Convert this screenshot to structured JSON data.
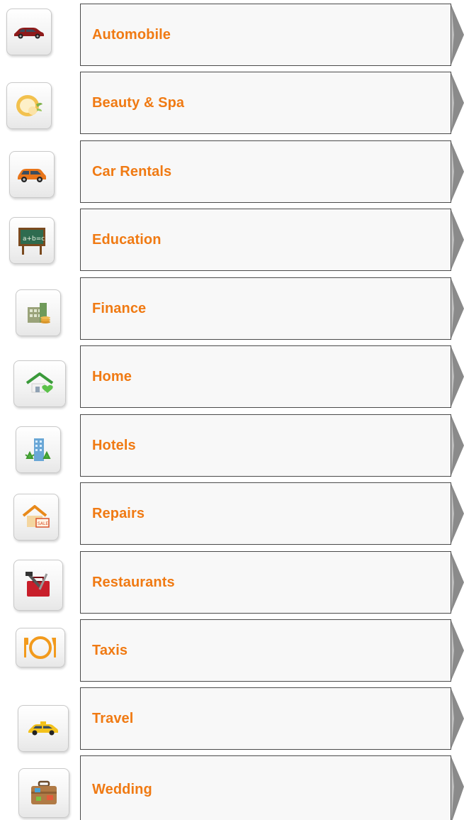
{
  "categories": [
    {
      "label": "Automobile",
      "icon": "car-icon"
    },
    {
      "label": "Beauty & Spa",
      "icon": "spa-icon"
    },
    {
      "label": "Car Rentals",
      "icon": "suv-icon"
    },
    {
      "label": "Education",
      "icon": "chalkboard-icon"
    },
    {
      "label": "Finance",
      "icon": "bank-icon"
    },
    {
      "label": "Home",
      "icon": "house-heart-icon"
    },
    {
      "label": "Hotels",
      "icon": "hotel-icon"
    },
    {
      "label": "Repairs",
      "icon": "house-sale-icon"
    },
    {
      "label": "Restaurants",
      "icon": "toolbox-icon"
    },
    {
      "label": "Taxis",
      "icon": "plate-cutlery-icon"
    },
    {
      "label": "Travel",
      "icon": "taxi-icon"
    },
    {
      "label": "Wedding",
      "icon": "suitcase-icon"
    }
  ],
  "colors": {
    "label": "#f07a13",
    "cell_border": "#4a4a4a",
    "cell_bg": "#f8f8f8",
    "arrow": "#8a8a8a"
  }
}
